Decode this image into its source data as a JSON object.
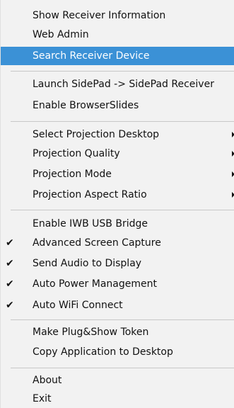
{
  "menu": {
    "items": [
      {
        "label": "Show Receiver Information"
      },
      {
        "label": "Web Admin"
      },
      {
        "label": "Search Receiver Device",
        "highlighted": true
      },
      {
        "label": "Launch SidePad -> SidePad Receiver"
      },
      {
        "label": "Enable BrowserSlides"
      },
      {
        "label": "Select Projection Desktop",
        "submenu": true
      },
      {
        "label": "Projection Quality",
        "submenu": true
      },
      {
        "label": "Projection Mode",
        "submenu": true
      },
      {
        "label": "Projection Aspect Ratio",
        "submenu": true
      },
      {
        "label": "Enable IWB USB Bridge"
      },
      {
        "label": "Advanced Screen Capture",
        "checked": true
      },
      {
        "label": "Send Audio to Display",
        "checked": true
      },
      {
        "label": "Auto Power Management",
        "checked": true
      },
      {
        "label": "Auto WiFi Connect",
        "checked": true
      },
      {
        "label": "Make Plug&Show Token"
      },
      {
        "label": "Copy Application to Desktop"
      },
      {
        "label": "About"
      },
      {
        "label": "Exit"
      }
    ],
    "check_glyph": "✔",
    "highlight_color": "#3b91d6"
  }
}
